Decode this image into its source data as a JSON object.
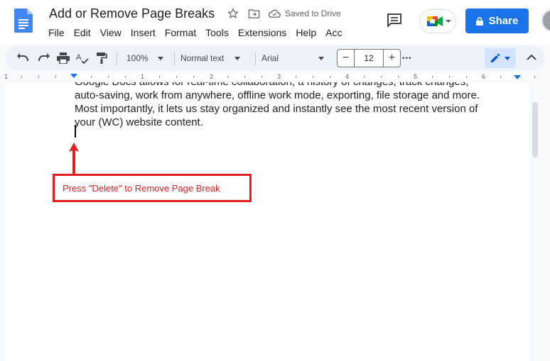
{
  "header": {
    "title": "Add or Remove Page Breaks",
    "saved_status": "Saved to Drive",
    "share_label": "Share"
  },
  "menu": {
    "items": [
      "File",
      "Edit",
      "View",
      "Insert",
      "Format",
      "Tools",
      "Extensions",
      "Help",
      "Acc"
    ]
  },
  "toolbar": {
    "zoom": "100%",
    "style": "Normal text",
    "font": "Arial",
    "font_size": "12",
    "minus": "−",
    "plus": "+",
    "more": "•••"
  },
  "ruler": {
    "numbers": [
      "1",
      "1",
      "2",
      "3",
      "4",
      "5",
      "6"
    ]
  },
  "document": {
    "lines": [
      "Google Docs allows for real-time collaboration, a history of changes, track changes,",
      "auto-saving, work from anywhere, offline work mode, exporting, file storage and more.",
      "Most importantly, it lets us stay organized and instantly see the most recent version of",
      "your (WC) website content."
    ]
  },
  "annotation": {
    "text": "Press \"Delete\" to Remove Page Break",
    "color": "#e02020"
  },
  "colors": {
    "accent": "#1a73e8",
    "toolbar_bg": "#edf2fa"
  }
}
